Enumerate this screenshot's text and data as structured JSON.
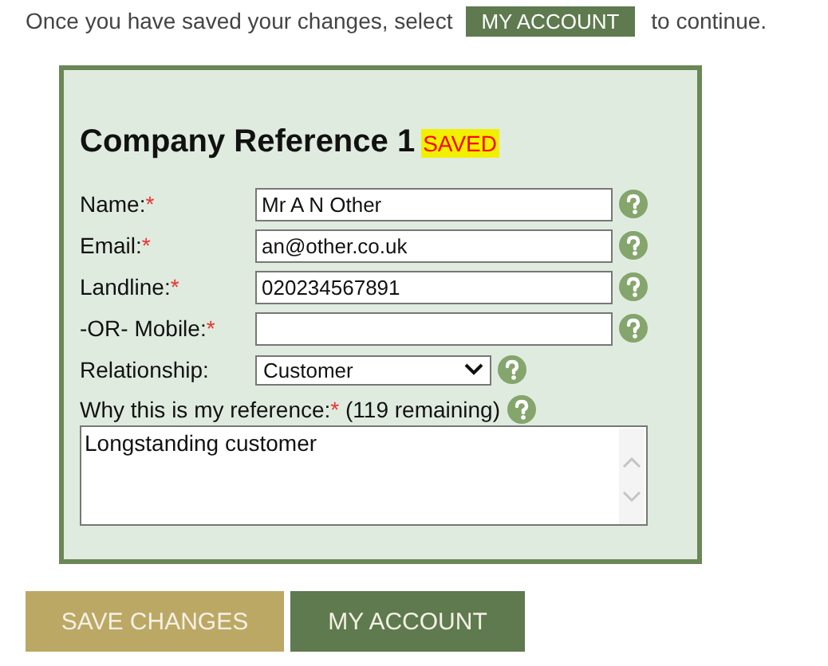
{
  "intro": {
    "before": "Once you have saved your changes, select",
    "button": "MY ACCOUNT",
    "after": "to continue."
  },
  "form": {
    "title": "Company Reference 1",
    "badge": "SAVED",
    "fields": [
      {
        "kind": "text",
        "label": "Name:",
        "required_mark": "*",
        "value": "Mr A N Other"
      },
      {
        "kind": "text",
        "label": "Email:",
        "required_mark": "*",
        "value": "an@other.co.uk"
      },
      {
        "kind": "text",
        "label": "Landline:",
        "required_mark": "*",
        "value": "020234567891"
      },
      {
        "kind": "text",
        "label": "-OR- Mobile:",
        "required_mark": "*"
      },
      {
        "kind": "select",
        "label": "Relationship:",
        "value": "Customer"
      }
    ],
    "reason": {
      "label": "Why this is my reference:",
      "required_mark": "*",
      "counter": "(119 remaining)",
      "value": "Longstanding customer"
    }
  },
  "buttons": [
    {
      "label": "SAVE CHANGES",
      "kind": "save"
    },
    {
      "label": "MY ACCOUNT",
      "kind": "account"
    }
  ]
}
